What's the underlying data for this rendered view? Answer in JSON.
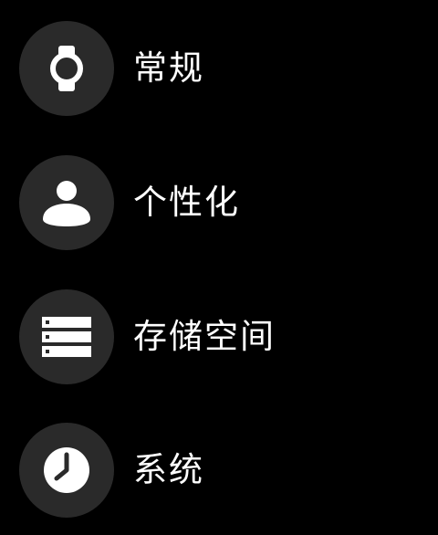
{
  "menu": {
    "items": [
      {
        "label": "常规",
        "icon": "watch-icon"
      },
      {
        "label": "个性化",
        "icon": "person-icon"
      },
      {
        "label": "存储空间",
        "icon": "storage-icon"
      },
      {
        "label": "系统",
        "icon": "clock-icon"
      }
    ]
  },
  "colors": {
    "background": "#000000",
    "icon_circle": "#2a2a2a",
    "foreground": "#ffffff"
  }
}
